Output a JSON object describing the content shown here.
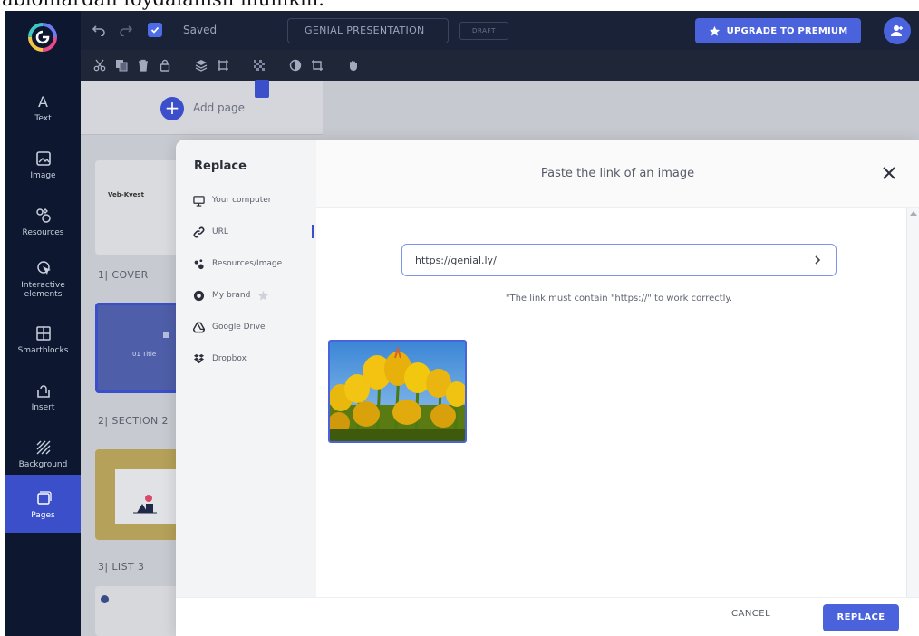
{
  "caption": {
    "text": "ablonlardan foydalanish mumkin."
  },
  "colors": {
    "rail_bg": "#0d1730",
    "accent": "#4a63dd",
    "topbar_bg": "#1a2238"
  },
  "rail": {
    "logo_icon": "genially-logo-icon",
    "items": [
      {
        "label": "Text",
        "icon": "text-icon"
      },
      {
        "label": "Image",
        "icon": "image-icon"
      },
      {
        "label": "Resources",
        "icon": "resources-icon"
      },
      {
        "label": "Interactive\nelements",
        "icon": "interactive-icon"
      },
      {
        "label": "Smartblocks",
        "icon": "smartblocks-icon"
      },
      {
        "label": "Insert",
        "icon": "insert-icon"
      },
      {
        "label": "Background",
        "icon": "background-icon"
      },
      {
        "label": "Pages",
        "icon": "pages-icon",
        "active": true
      }
    ]
  },
  "topbar": {
    "saved": "Saved",
    "presentation_title": "GENIAL PRESENTATION",
    "status": "DRAFT",
    "upgrade": "UPGRADE TO PREMIUM"
  },
  "pages_panel": {
    "add_page": "Add page",
    "pages": [
      {
        "label": "1| COVER",
        "thumb_title": "Veb-Kvest"
      },
      {
        "label": "2| SECTION 2",
        "thumb_title": "01 Title"
      },
      {
        "label": "3| LIST 3",
        "thumb_title": ""
      }
    ]
  },
  "modal": {
    "sidebar_title": "Replace",
    "sources": [
      {
        "label": "Your computer",
        "icon": "monitor-icon"
      },
      {
        "label": "URL",
        "icon": "link-icon",
        "active": true
      },
      {
        "label": "Resources/Image",
        "icon": "resources-icon"
      },
      {
        "label": "My brand",
        "icon": "brand-icon",
        "premium": true
      },
      {
        "label": "Google Drive",
        "icon": "google-drive-icon"
      },
      {
        "label": "Dropbox",
        "icon": "dropbox-icon"
      }
    ],
    "title": "Paste the link of an image",
    "url_value": "https://genial.ly/",
    "hint": "\"The link must contain \"https://\" to work correctly.",
    "preview_image": "yellow-tulips",
    "cancel": "CANCEL",
    "replace": "REPLACE"
  }
}
